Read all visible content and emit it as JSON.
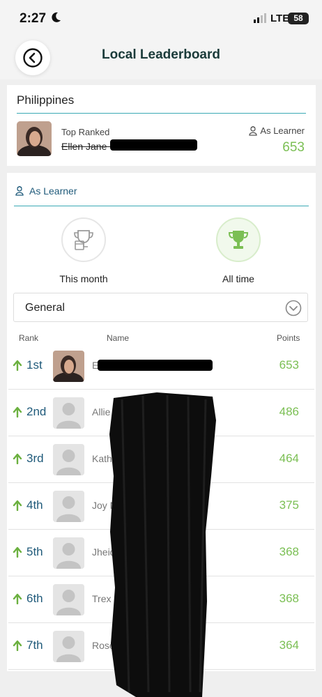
{
  "status": {
    "time": "2:27",
    "network": "LTE",
    "battery": "58"
  },
  "header": {
    "title": "Local Leaderboard"
  },
  "country_card": {
    "country": "Philippines",
    "top_ranked_label": "Top Ranked",
    "top_ranked_name": "Ellen Jane G",
    "role_label": "As Learner",
    "points": "653"
  },
  "leaderboard": {
    "tab_label": "As Learner",
    "periods": [
      {
        "label": "This month",
        "selected": false
      },
      {
        "label": "All time",
        "selected": true
      }
    ],
    "category": "General",
    "columns": {
      "rank": "Rank",
      "name": "Name",
      "points": "Points"
    },
    "rows": [
      {
        "rank": "1st",
        "name": "Ellen",
        "points": "653"
      },
      {
        "rank": "2nd",
        "name": "Allie",
        "points": "486"
      },
      {
        "rank": "3rd",
        "name": "Kathe",
        "points": "464"
      },
      {
        "rank": "4th",
        "name": "Joy N",
        "points": "375"
      },
      {
        "rank": "5th",
        "name": "Jheid",
        "points": "368"
      },
      {
        "rank": "6th",
        "name": "Trex",
        "points": "368"
      },
      {
        "rank": "7th",
        "name": "Rose Anne",
        "points": "364"
      }
    ]
  },
  "colors": {
    "accent_green": "#7bbf54",
    "rank_blue": "#1f5a7a",
    "divider_teal": "#3aa9b5",
    "title_dark": "#1b3b3a"
  },
  "icons": [
    "moon-icon",
    "signal-icon",
    "back-arrow-icon",
    "learner-icon",
    "trophy-icon",
    "chevron-down-icon",
    "up-arrow-icon",
    "avatar-placeholder-icon"
  ]
}
